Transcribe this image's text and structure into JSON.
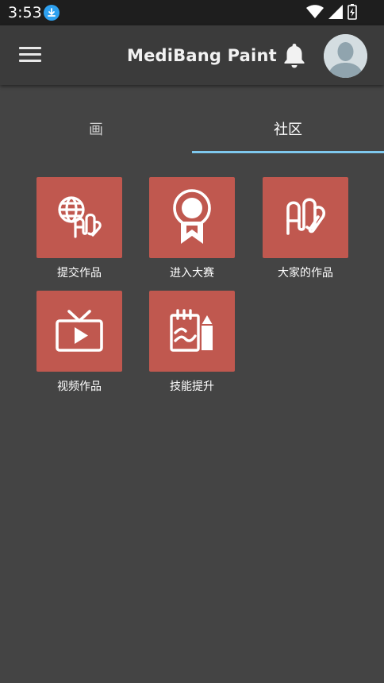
{
  "status": {
    "time": "3:53"
  },
  "app": {
    "title": "MediBang Paint"
  },
  "tabs": [
    {
      "label": "画",
      "active": false
    },
    {
      "label": "社区",
      "active": true
    }
  ],
  "tiles": [
    {
      "label": "提交作品",
      "icon": "globe-clip-icon"
    },
    {
      "label": "进入大赛",
      "icon": "award-ribbon-icon"
    },
    {
      "label": "大家的作品",
      "icon": "clip-a-icon"
    },
    {
      "label": "视频作品",
      "icon": "tv-play-icon"
    },
    {
      "label": "技能提升",
      "icon": "notebook-pencil-icon"
    }
  ],
  "colors": {
    "background": "#444444",
    "appbar": "#3b3b3b",
    "tile": "#c0584f",
    "tab_indicator": "#7ec8ee"
  }
}
